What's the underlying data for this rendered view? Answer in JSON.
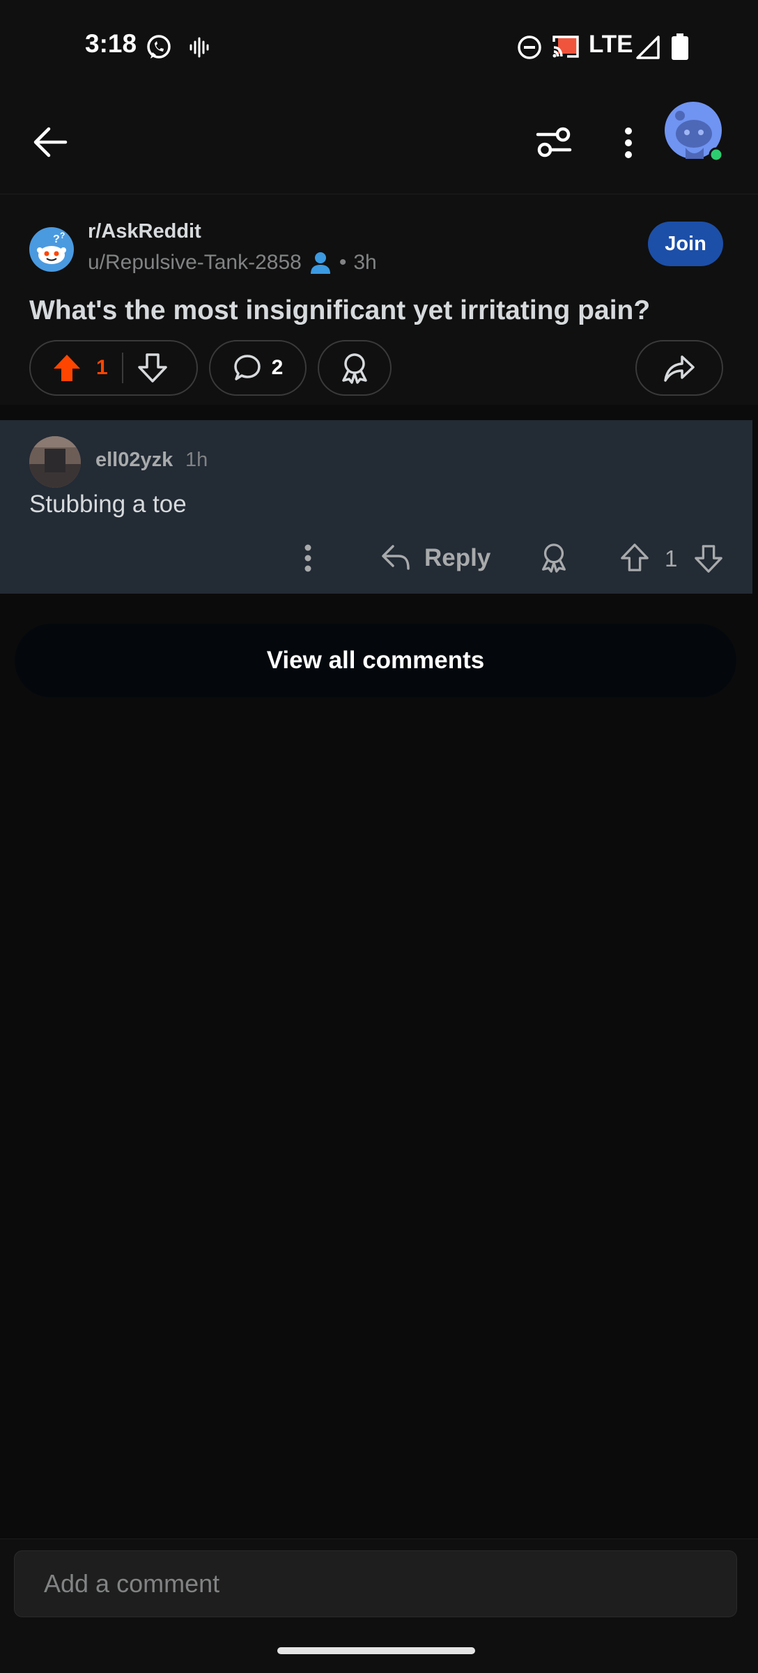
{
  "status_bar": {
    "time": "3:18",
    "network": "LTE"
  },
  "post": {
    "subreddit": "r/AskReddit",
    "author": "u/Repulsive-Tank-2858",
    "separator": "•",
    "age": "3h",
    "join_label": "Join",
    "title": "What's the most insignificant yet irritating pain?",
    "vote_count": "1",
    "comment_count": "2"
  },
  "comment": {
    "author": "ell02yzk",
    "age": "1h",
    "body": "Stubbing a toe",
    "reply_label": "Reply",
    "vote_count": "1"
  },
  "view_all_label": "View all comments",
  "comment_input": {
    "placeholder": "Add a comment"
  },
  "colors": {
    "upvote": "#ff4500",
    "join": "#1c4fa8",
    "comment_bg": "#232b35",
    "online": "#2ecc71"
  }
}
